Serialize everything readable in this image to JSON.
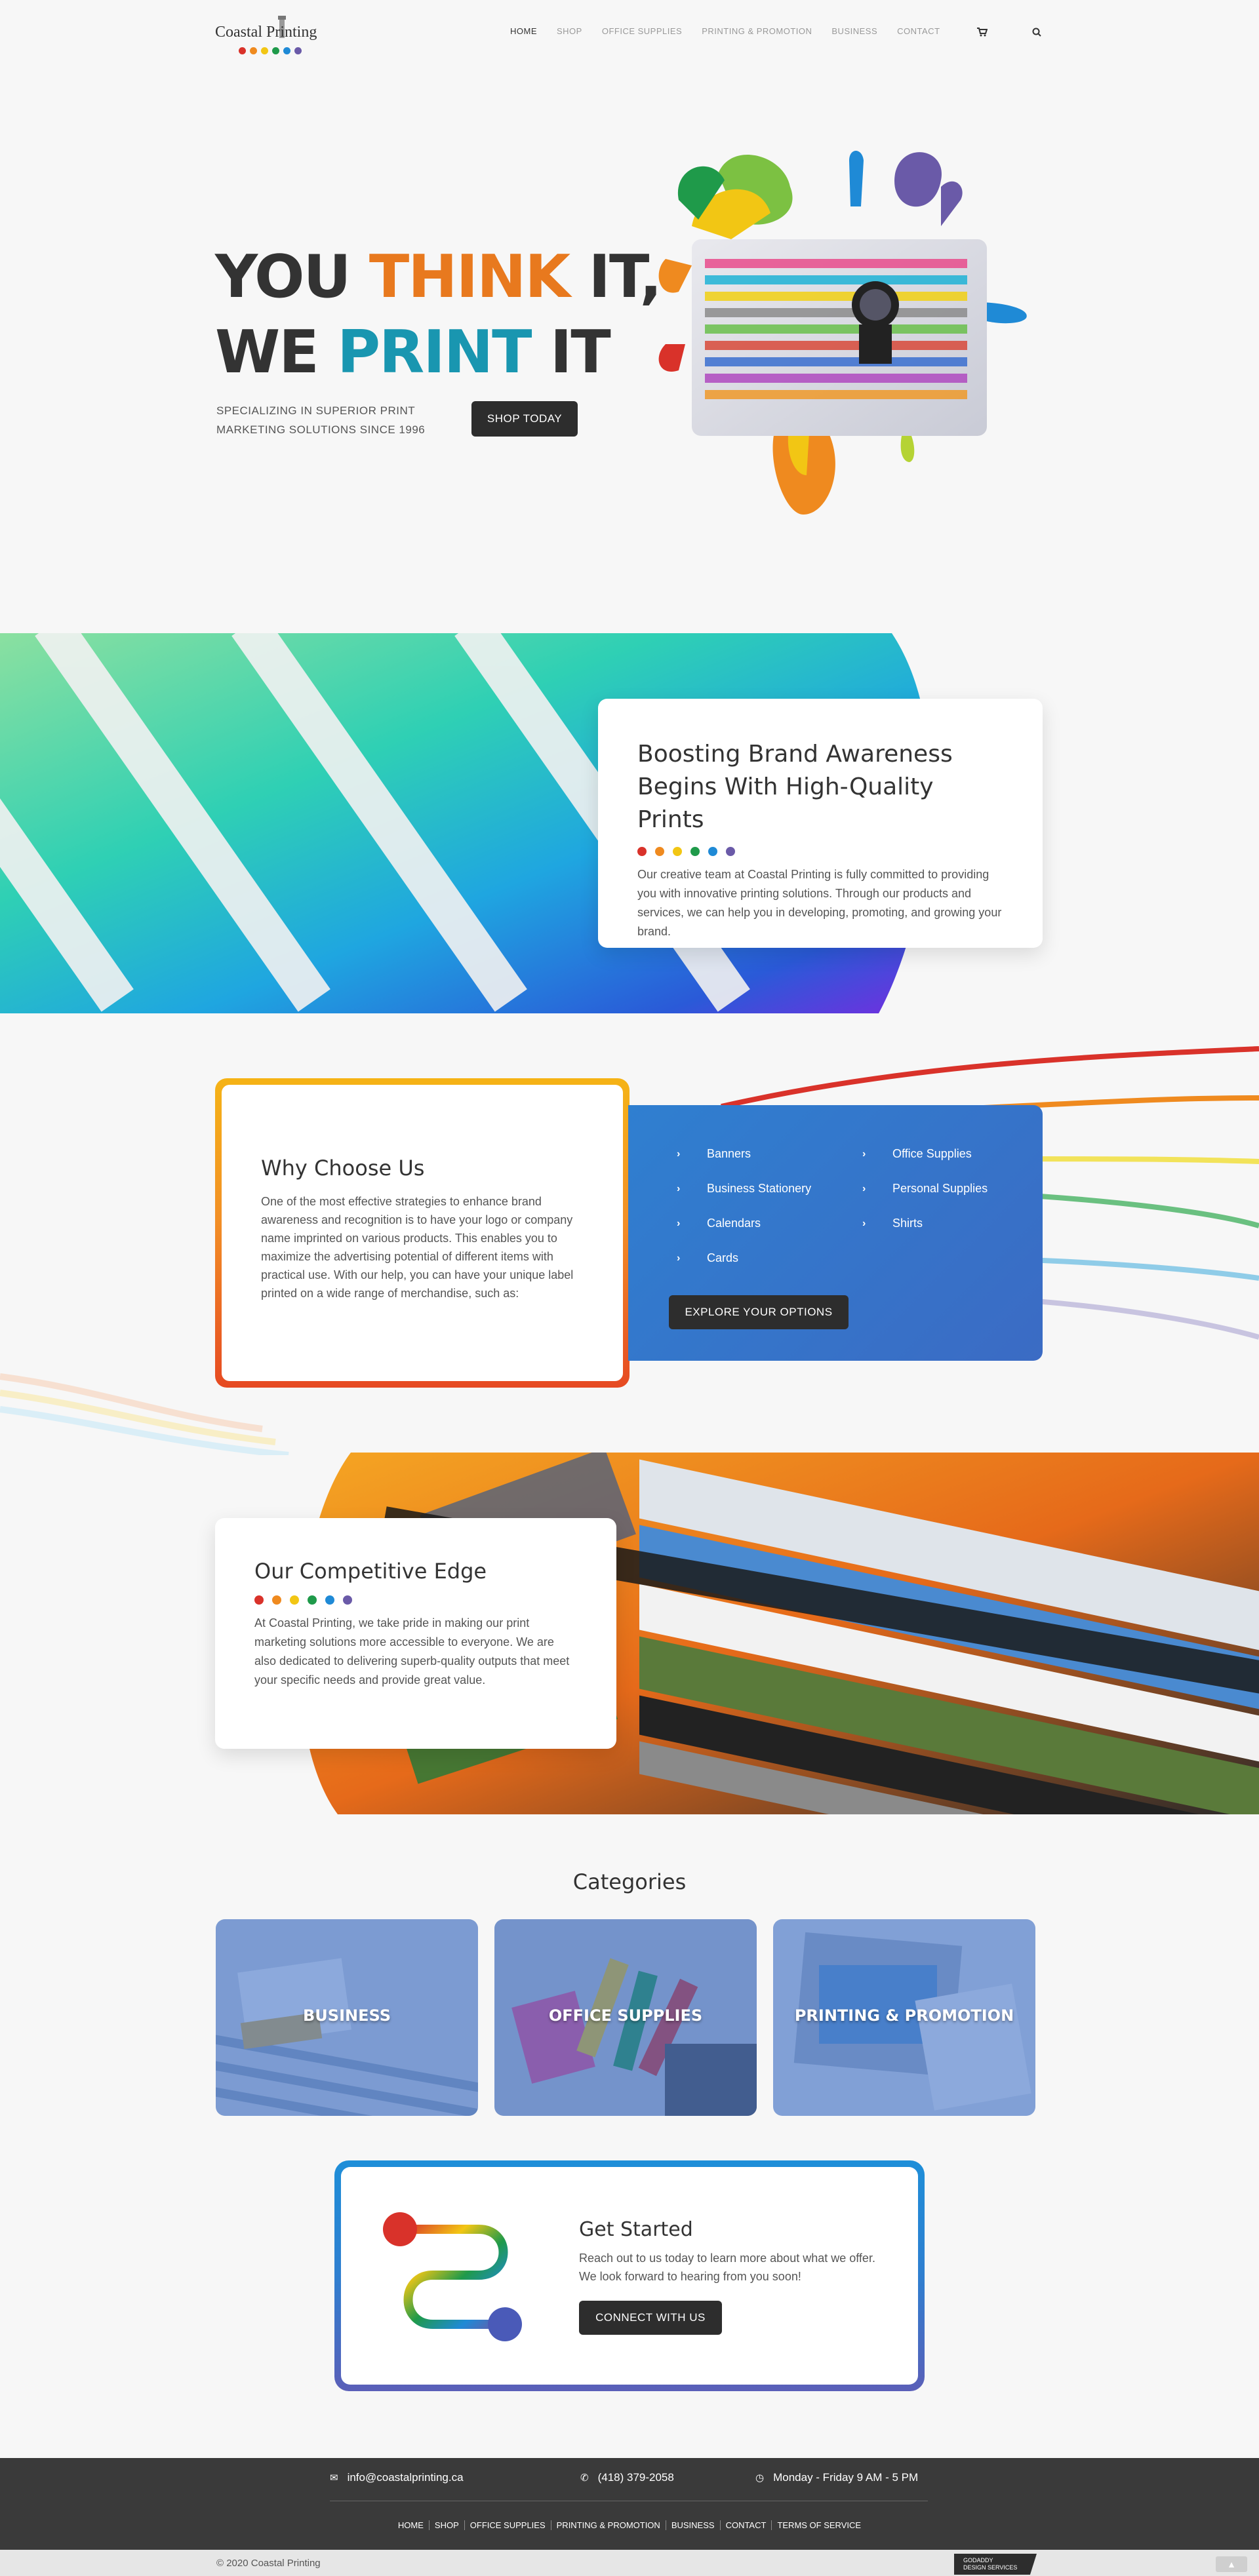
{
  "colors": {
    "red": "#d9322a",
    "orange": "#ef8a1f",
    "yellow": "#f2c614",
    "green": "#1f9a4a",
    "blue": "#1f8ad6",
    "purple": "#6a5aa8",
    "accent_blue": "#2f7fd0",
    "dark": "#2d2d2d"
  },
  "header": {
    "logo_text": "Coastal Printing",
    "nav": [
      "HOME",
      "SHOP",
      "OFFICE SUPPLIES",
      "PRINTING & PROMOTION",
      "BUSINESS",
      "CONTACT"
    ],
    "active_nav": "HOME",
    "cart_icon": "cart-icon",
    "search_icon": "search-icon"
  },
  "hero": {
    "line1_a": "YOU ",
    "line1_b": "THINK",
    "line1_c": " IT,",
    "line2_a": "WE ",
    "line2_b": "PRINT",
    "line2_c": " IT",
    "subtitle": "SPECIALIZING IN SUPERIOR PRINT MARKETING SOLUTIONS SINCE 1996",
    "cta": "SHOP TODAY"
  },
  "brand": {
    "title": "Boosting Brand Awareness Begins With High-Quality Prints",
    "body": "Our creative team at Coastal Printing is fully committed to providing you with innovative printing solutions. Through our products and services, we can help you in developing, promoting, and growing your brand."
  },
  "why": {
    "title": "Why Choose Us",
    "body": "One of the most effective strategies to enhance brand awareness and recognition is to have your logo or company name imprinted on various products. This enables you to maximize the advertising potential of different items with practical use. With our help, you can have your unique label printed on a wide range of merchandise, such as:",
    "options": [
      "Banners",
      "Office Supplies",
      "Business Stationery",
      "Personal Supplies",
      "Calendars",
      "Shirts",
      "Cards"
    ],
    "cta": "EXPLORE YOUR OPTIONS"
  },
  "edge": {
    "title": "Our Competitive Edge",
    "body": "At Coastal Printing, we take pride in making our print marketing solutions more accessible to everyone. We are also dedicated to delivering superb-quality outputs that meet your specific needs and provide great value."
  },
  "categories": {
    "title": "Categories",
    "items": [
      "BUSINESS",
      "OFFICE SUPPLIES",
      "PRINTING & PROMOTION"
    ]
  },
  "get_started": {
    "title": "Get Started",
    "body": "Reach out to us today to learn more about what we offer. We look forward to hearing from you soon!",
    "cta": "CONNECT WITH US"
  },
  "footer": {
    "email": "info@coastalprinting.ca",
    "phone": "(418) 379-2058",
    "hours": "Monday - Friday 9 AM - 5 PM",
    "links": [
      "HOME",
      "SHOP",
      "OFFICE SUPPLIES",
      "PRINTING & PROMOTION",
      "BUSINESS",
      "CONTACT",
      "TERMS OF SERVICE"
    ],
    "copyright": "© 2020 Coastal Printing",
    "badge_line1": "GODADDY",
    "badge_line2": "DESIGN SERVICES"
  }
}
